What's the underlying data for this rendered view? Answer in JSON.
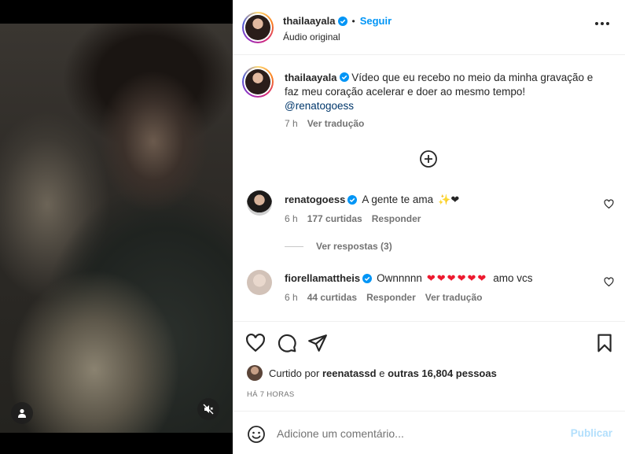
{
  "post_author": {
    "username": "thailaayala",
    "follow_label": "Seguir",
    "separator": "•",
    "audio_label": "Áudio original"
  },
  "caption": {
    "username": "thailaayala",
    "text": "Vídeo que eu recebo no meio da minha gravação e faz meu coração acelerar e doer ao mesmo tempo!",
    "mention": "@renatogoess",
    "time": "7 h",
    "translate_label": "Ver tradução"
  },
  "comments": [
    {
      "username": "renatogoess",
      "text": "A gente te ama",
      "emojis": "✨❤",
      "time": "6 h",
      "likes": "177 curtidas",
      "reply_label": "Responder",
      "replies_label": "Ver respostas (3)"
    },
    {
      "username": "fiorellamattheis",
      "text": "Ownnnnn",
      "hearts": "❤❤❤❤❤❤",
      "suffix": "amo vcs",
      "time": "6 h",
      "likes": "44 curtidas",
      "reply_label": "Responder",
      "translate_label": "Ver tradução"
    }
  ],
  "likes_summary": {
    "prefix": "Curtido por",
    "user": "reenatassd",
    "middle": "e",
    "others": "outras 16,804 pessoas"
  },
  "time_ago": "HÁ 7 HORAS",
  "add_comment": {
    "placeholder": "Adicione um comentário...",
    "post_label": "Publicar"
  },
  "colors": {
    "accent": "#0095f6",
    "post_disabled": "#b2dffc",
    "heart": "#ed1a2f"
  }
}
